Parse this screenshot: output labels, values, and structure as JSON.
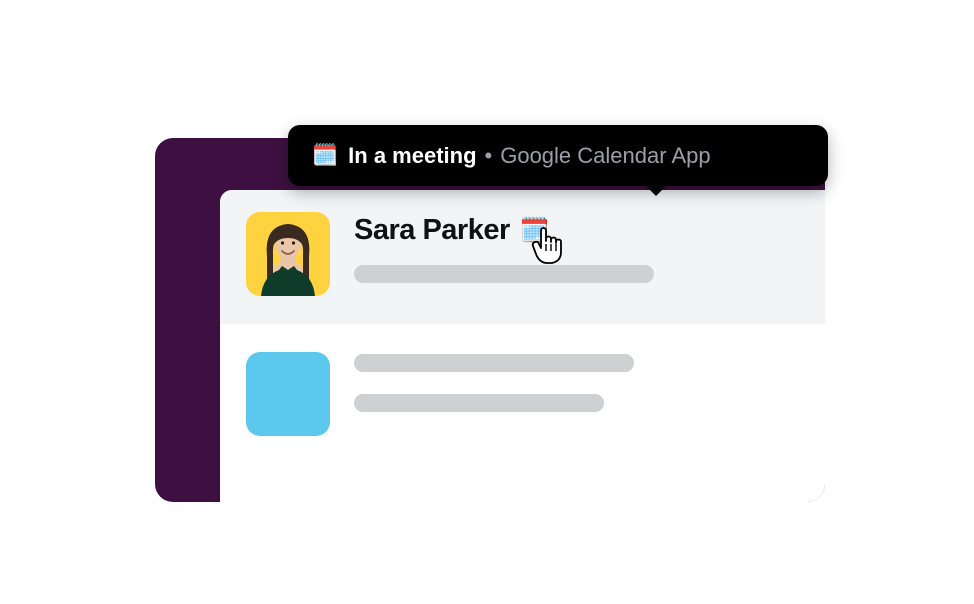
{
  "tooltip": {
    "emoji": "🗓️",
    "status_text": "In a meeting",
    "separator": "•",
    "source_text": "Google Calendar App"
  },
  "user": {
    "name": "Sara Parker",
    "status_emoji": "🗓️"
  }
}
